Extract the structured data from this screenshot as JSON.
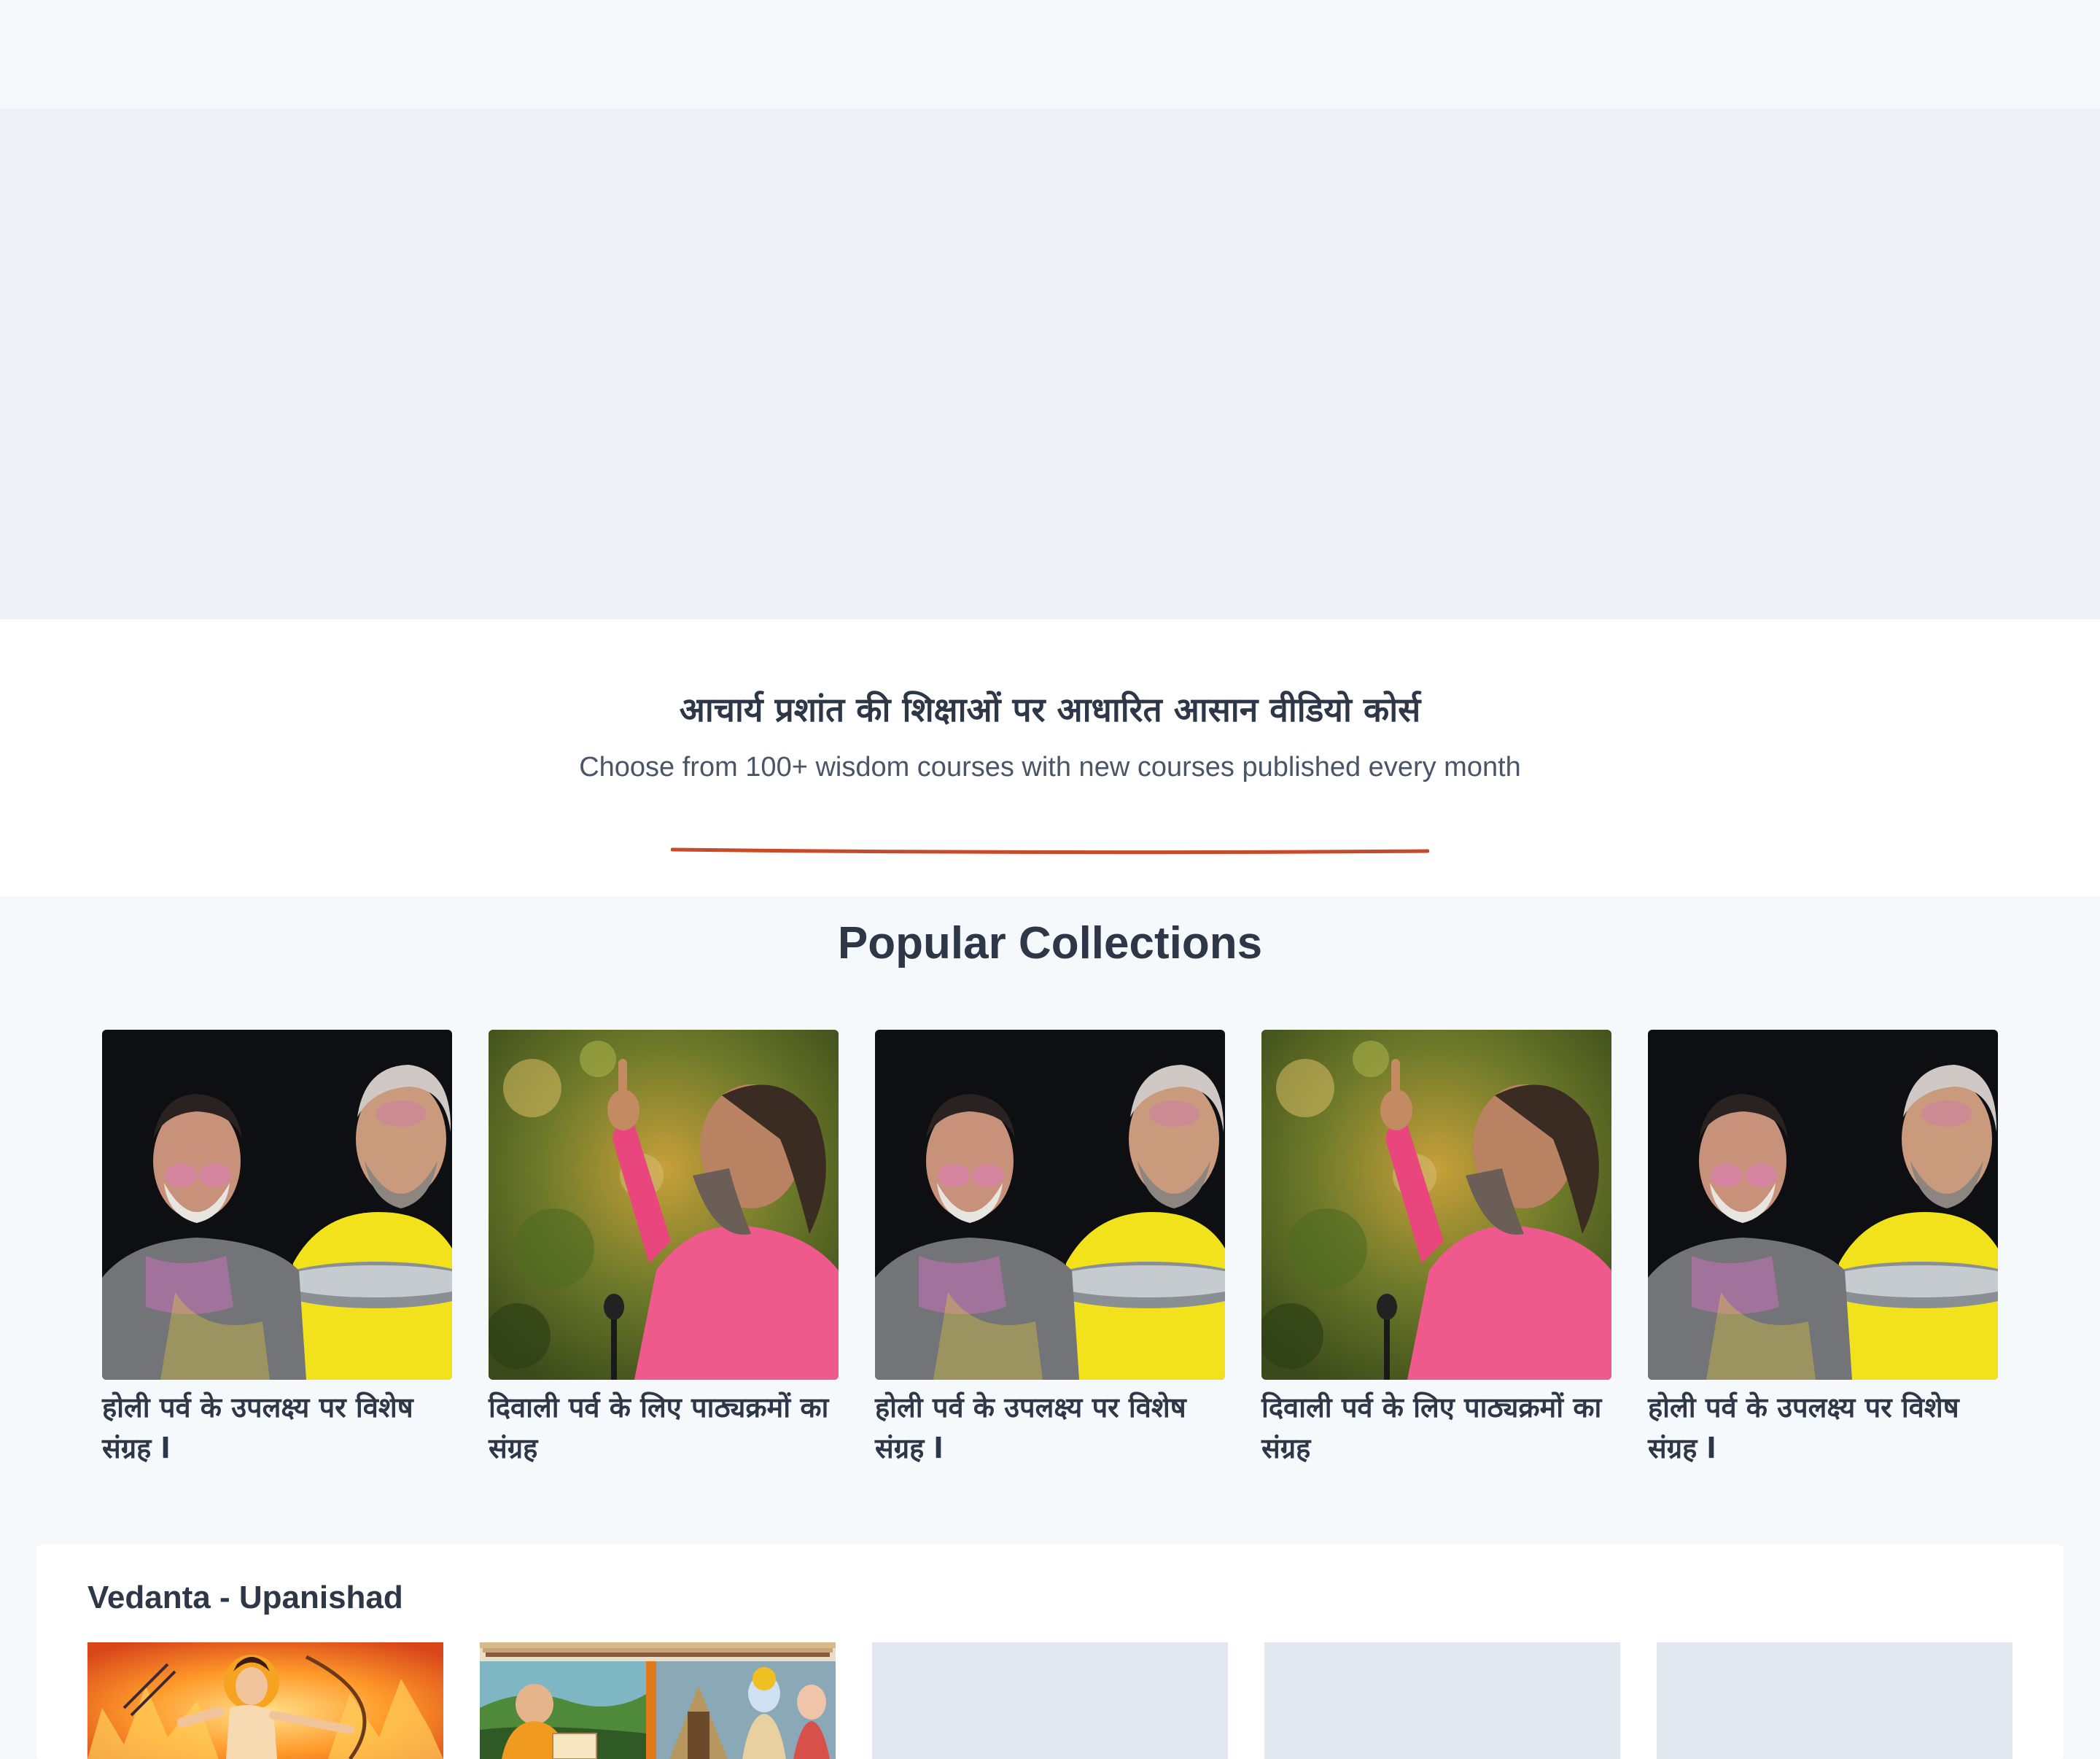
{
  "intro": {
    "title_hi": "आचार्य प्रशांत की शिक्षाओं पर आधारित आसान वीडियो कोर्स",
    "subtitle": "Choose from 100+ wisdom courses with new courses published every month"
  },
  "colors": {
    "accent": "#c84a2a",
    "placeholder": "#e2e8f0",
    "text": "#2d3748"
  },
  "popular": {
    "title": "Popular Collections",
    "items": [
      {
        "caption": "होली पर्व के उपलक्ष्य पर विशेष संग्रह l",
        "image": "holi-photo"
      },
      {
        "caption": "दिवाली पर्व के लिए पाठ्यक्रमों का संग्रह",
        "image": "diwali-photo"
      },
      {
        "caption": "होली पर्व के उपलक्ष्य पर विशेष संग्रह l",
        "image": "holi-photo"
      },
      {
        "caption": "दिवाली पर्व के लिए पाठ्यक्रमों का संग्रह",
        "image": "diwali-photo"
      },
      {
        "caption": "होली पर्व के उपलक्ष्य पर विशेष संग्रह l",
        "image": "holi-photo"
      }
    ]
  },
  "vedanta": {
    "title": "Vedanta - Upanishad",
    "cards": [
      {
        "image": "rama-archer-art"
      },
      {
        "image": "sage-and-rama-art"
      },
      {
        "image": "placeholder"
      },
      {
        "image": "placeholder"
      },
      {
        "image": "placeholder"
      }
    ]
  }
}
